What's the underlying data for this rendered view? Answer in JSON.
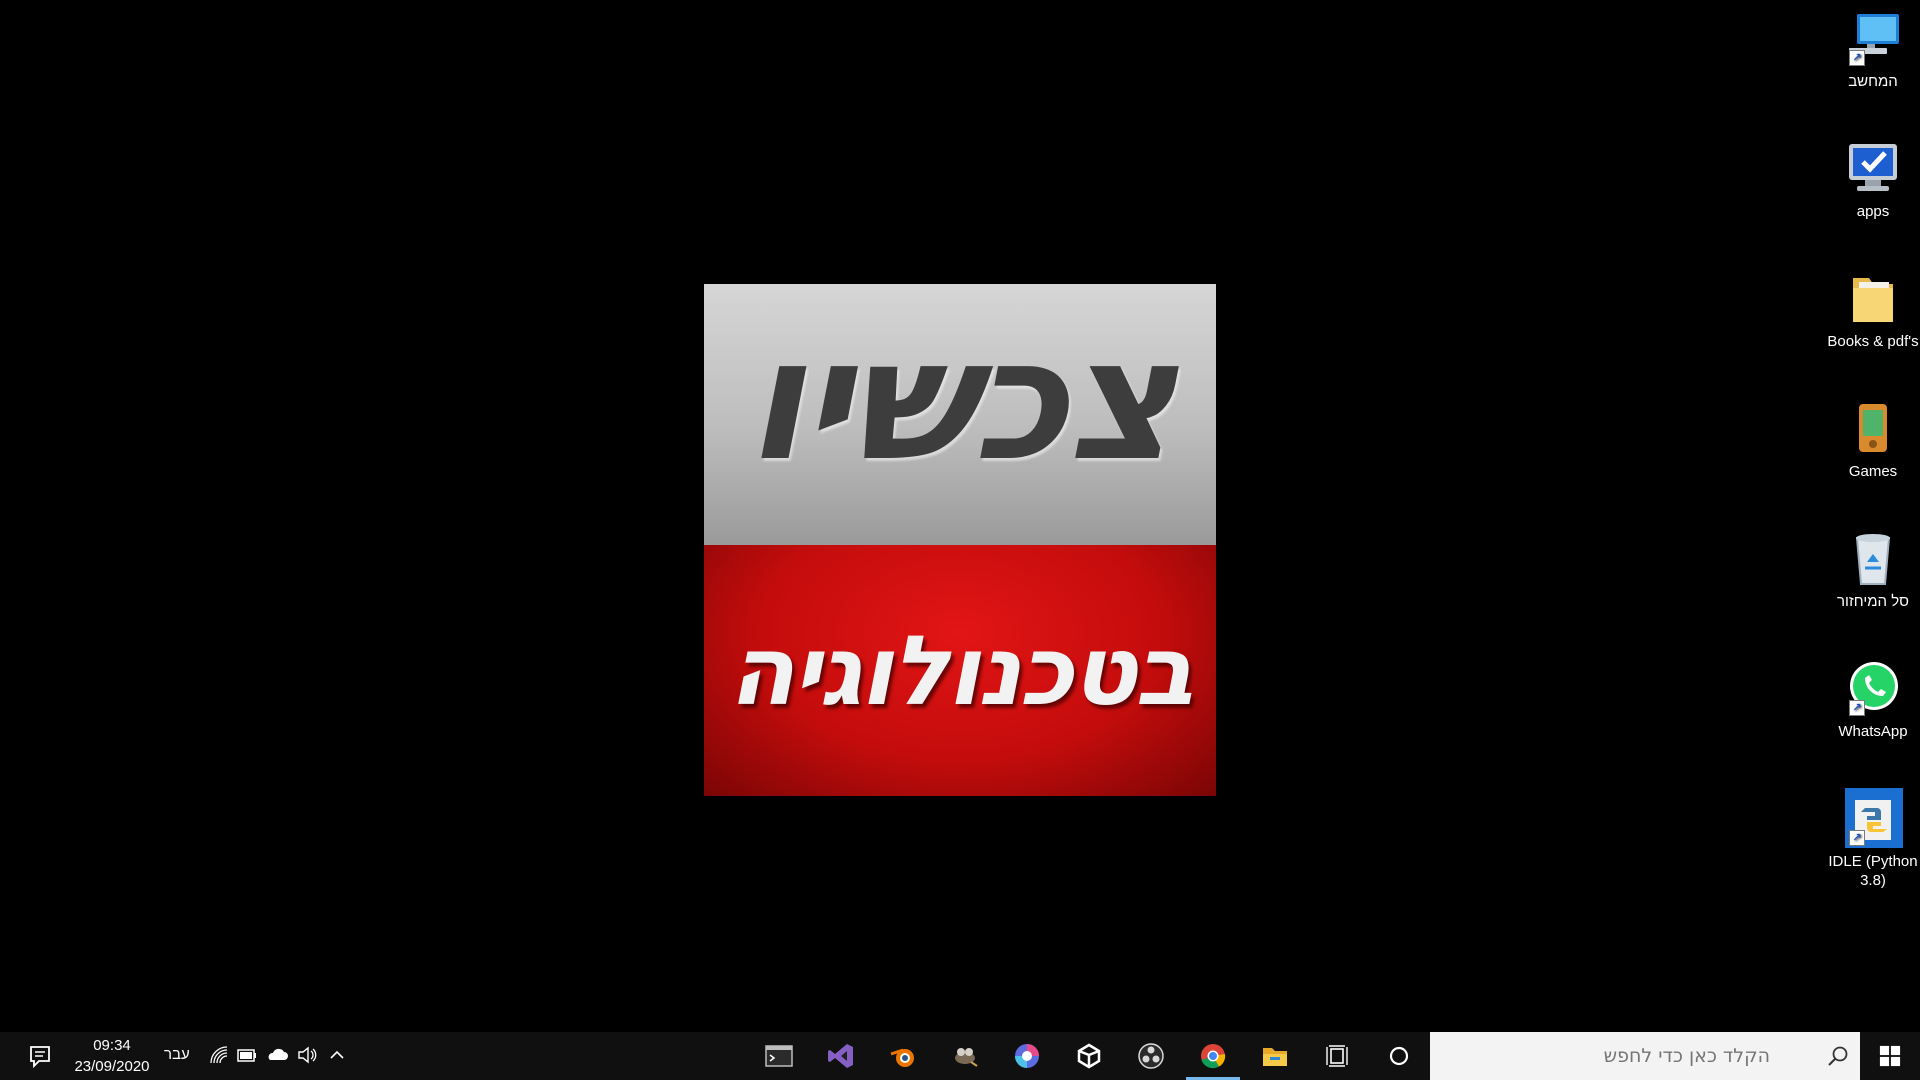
{
  "wallpaper": {
    "top_text": "צכשיו",
    "bottom_text": "בטכנולוגיה",
    "colors": {
      "top": "#c4c4c4",
      "bottom": "#c40c0c",
      "top_text": "#3d3d3d",
      "bottom_text": "#f2f2f2"
    }
  },
  "desktop_icons": [
    {
      "label": "המחשב",
      "icon": "this-pc-icon",
      "shortcut": true
    },
    {
      "label": "apps",
      "icon": "monitor-check-icon",
      "shortcut": false
    },
    {
      "label": "Books & pdf's",
      "icon": "folder-icon",
      "shortcut": false
    },
    {
      "label": "Games",
      "icon": "games-folder-icon",
      "shortcut": false
    },
    {
      "label": "סל המיחזור",
      "icon": "recycle-bin-icon",
      "shortcut": false
    },
    {
      "label": "WhatsApp",
      "icon": "whatsapp-icon",
      "shortcut": true
    },
    {
      "label": "IDLE (Python 3.8)",
      "icon": "python-idle-icon",
      "shortcut": true
    }
  ],
  "taskbar": {
    "search_placeholder": "הקלד כאן כדי לחפש",
    "clock": {
      "time": "09:34",
      "date": "23/09/2020"
    },
    "language": "עבר",
    "apps": [
      {
        "name": "terminal-icon"
      },
      {
        "name": "visual-studio-icon"
      },
      {
        "name": "blender-icon"
      },
      {
        "name": "gimp-icon"
      },
      {
        "name": "krita-icon"
      },
      {
        "name": "unity-icon"
      },
      {
        "name": "obs-icon"
      },
      {
        "name": "chrome-icon",
        "active": true
      },
      {
        "name": "file-explorer-icon"
      },
      {
        "name": "task-view-icon"
      },
      {
        "name": "cortana-icon"
      }
    ],
    "accent": "#76b9ed"
  }
}
